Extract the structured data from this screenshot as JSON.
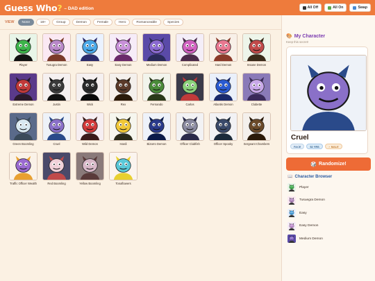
{
  "header": {
    "title_main": "Guess Who",
    "title_q": "?",
    "subtitle": "– DAD edition",
    "buttons": [
      {
        "label": "All Off",
        "color": "#333333"
      },
      {
        "label": "All On",
        "color": "#5aa84a"
      },
      {
        "label": "Swap",
        "color": "#4a8ad0"
      }
    ]
  },
  "filters": {
    "view_label": "VIEW",
    "chips": [
      "None",
      "18+",
      "Group",
      "Demon",
      "Female",
      "Hero",
      "Romanceable",
      "Species"
    ],
    "active": "None"
  },
  "characters": [
    {
      "name": "Player",
      "bg": "#e8f5e8",
      "skin": "#3cb34a",
      "accent": "#111111"
    },
    {
      "name": "Tusugra Demon",
      "bg": "#fbe9f3",
      "skin": "#b888c8",
      "accent": "#7a3a2a"
    },
    {
      "name": "Easy",
      "bg": "#eaf2ff",
      "skin": "#4aa8e8",
      "accent": "#2a2a6a"
    },
    {
      "name": "Easy Demon",
      "bg": "#f6ecf8",
      "skin": "#c890d8",
      "accent": "#6a2a6a"
    },
    {
      "name": "Medium Demon",
      "bg": "#5a4aa8",
      "skin": "#8a6ad0",
      "accent": "#2a2a5a"
    },
    {
      "name": "Complicated",
      "bg": "#f4eef8",
      "skin": "#d060c0",
      "accent": "#4a2a4a"
    },
    {
      "name": "Hard Demon",
      "bg": "#f8f0e8",
      "skin": "#e87890",
      "accent": "#8a3a2a"
    },
    {
      "name": "Insane Demon",
      "bg": "#eef5ea",
      "skin": "#c04a4a",
      "accent": "#3a2a1a"
    },
    {
      "name": "Extreme Demon",
      "bg": "#5a3a8a",
      "skin": "#c03a3a",
      "accent": "#2a1a2a"
    },
    {
      "name": "Justin",
      "bg": "#f5f0f0",
      "skin": "#3a3a3a",
      "accent": "#111111"
    },
    {
      "name": "Wick",
      "bg": "#f5f0f0",
      "skin": "#2a2a2a",
      "accent": "#0a0a0a"
    },
    {
      "name": "Rex",
      "bg": "#f4f0ec",
      "skin": "#5a3a2a",
      "accent": "#2a1a0a"
    },
    {
      "name": "Fernando",
      "bg": "#f2f4ec",
      "skin": "#4a8a3a",
      "accent": "#2a3a1a"
    },
    {
      "name": "Carlos",
      "bg": "#3a3a4a",
      "skin": "#8ad07a",
      "accent": "#c03a3a"
    },
    {
      "name": "Atlantis Demon",
      "bg": "#eaf0fa",
      "skin": "#2a5ad0",
      "accent": "#1a2a6a"
    },
    {
      "name": "Clubette",
      "bg": "#8a7ab8",
      "skin": "#c8a8e8",
      "accent": "#3a2a5a"
    },
    {
      "name": "Green Boomling",
      "bg": "#5a6a8a",
      "skin": "#d8e8f0",
      "accent": "#3a4a5a"
    },
    {
      "name": "Cruel",
      "bg": "#eef2f8",
      "skin": "#8a70c8",
      "accent": "#2a4a8a"
    },
    {
      "name": "Wild Demon",
      "bg": "#f6eef2",
      "skin": "#d03a3a",
      "accent": "#3a1a1a"
    },
    {
      "name": "Hardi",
      "bg": "#f6f6ee",
      "skin": "#f0c838",
      "accent": "#2a2a1a"
    },
    {
      "name": "Bizarro Demon",
      "bg": "#eef2fa",
      "skin": "#2a3a8a",
      "accent": "#0a1a4a"
    },
    {
      "name": "Officer Clubfish",
      "bg": "#f2f2f4",
      "skin": "#8a8aa0",
      "accent": "#2a2a4a"
    },
    {
      "name": "Officer Spooky",
      "bg": "#f2f2f4",
      "skin": "#3a4a6a",
      "accent": "#1a2a3a"
    },
    {
      "name": "Sergeant Chambers",
      "bg": "#f4f0ec",
      "skin": "#6a4a2a",
      "accent": "#2a1a0a"
    },
    {
      "name": "Traffic Officer Wealth",
      "bg": "#faf2e8",
      "skin": "#9a6ad0",
      "accent": "#e8a030"
    },
    {
      "name": "Red Boomling",
      "bg": "#4a4a6a",
      "skin": "#f0d0d8",
      "accent": "#c04a4a"
    },
    {
      "name": "Yellow Boomling",
      "bg": "#8a7a7a",
      "skin": "#d8b8c8",
      "accent": "#5a3a3a"
    },
    {
      "name": "Tonaflowers",
      "bg": "#fbf4ee",
      "skin": "#5ac8d8",
      "accent": "#e8d030"
    }
  ],
  "my_character": {
    "heading": "My Character",
    "sub": "Keep this secret!",
    "name": "Cruel",
    "tags": [
      "FACE",
      "52 YRS",
      "♂ MALE"
    ],
    "skin": "#8a70c8",
    "bg": "#eef2f8",
    "accent": "#2a4a8a"
  },
  "randomize_label": "Randomize!",
  "browser": {
    "heading": "Character Browser",
    "items": [
      {
        "name": "Player",
        "skin": "#3cb34a",
        "bg": "#e8f5e8"
      },
      {
        "name": "Tusuegra Demon",
        "skin": "#b888c8",
        "bg": "#fbe9f3"
      },
      {
        "name": "Easy",
        "skin": "#4aa8e8",
        "bg": "#eaf2ff"
      },
      {
        "name": "Easy Demon",
        "skin": "#c890d8",
        "bg": "#f6ecf8"
      },
      {
        "name": "Medium Demon",
        "skin": "#8a6ad0",
        "bg": "#5a4aa8"
      }
    ]
  }
}
